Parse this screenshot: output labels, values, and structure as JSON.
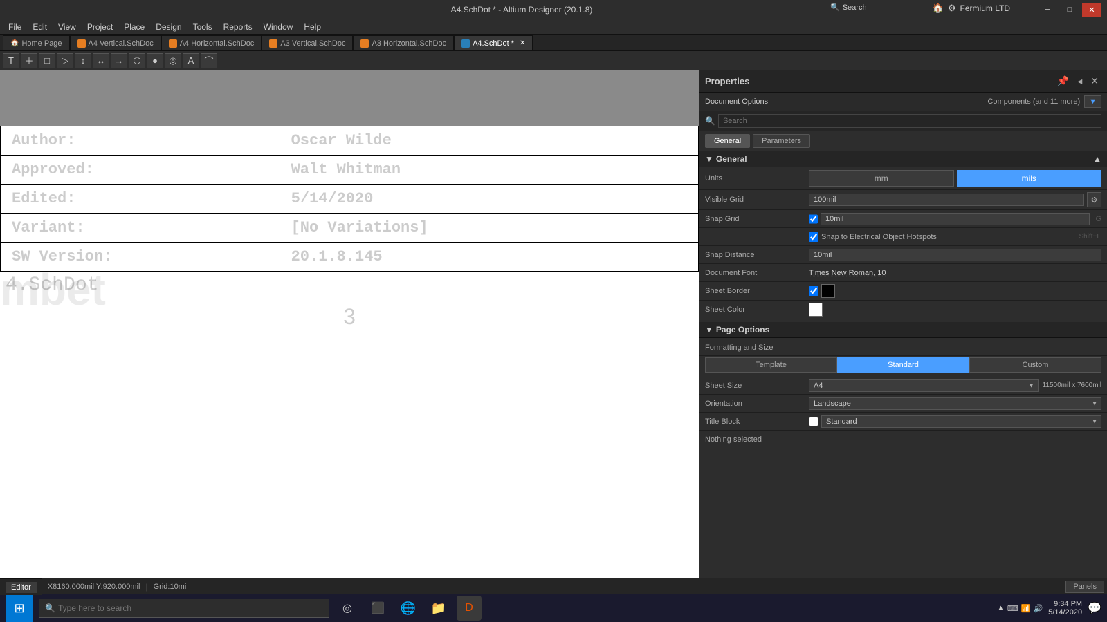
{
  "titlebar": {
    "title": "A4.SchDot * - Altium Designer (20.1.8)",
    "search_label": "Search",
    "win_min": "─",
    "win_max": "□",
    "win_close": "✕"
  },
  "topright": {
    "icons": [
      "🏠",
      "⚙"
    ],
    "company": "Fermium LTD"
  },
  "menubar": {
    "items": [
      "File",
      "Edit",
      "View",
      "Project",
      "Place",
      "Design",
      "Tools",
      "Reports",
      "Window",
      "Help"
    ]
  },
  "tabs": [
    {
      "label": "Home Page",
      "icon": "home",
      "active": false
    },
    {
      "label": "A4 Vertical.SchDoc",
      "active": false
    },
    {
      "label": "A4 Horizontal.SchDoc",
      "active": false
    },
    {
      "label": "A3 Vertical.SchDoc",
      "active": false
    },
    {
      "label": "A3 Horizontal.SchDoc",
      "active": false
    },
    {
      "label": "A4.SchDot *",
      "active": true
    }
  ],
  "toolbar": {
    "buttons": [
      "T",
      "＋",
      "□",
      "▷",
      "↕",
      "↔",
      "→",
      "⬡",
      "●",
      "◎",
      "A",
      "⌒"
    ]
  },
  "canvas": {
    "author_label": "Author:",
    "author_value": "Oscar Wilde",
    "approved_label": "Approved:",
    "approved_value": "Walt Whitman",
    "edited_label": "Edited:",
    "edited_value": "5/14/2020",
    "variant_label": "Variant:",
    "variant_value": "[No Variations]",
    "sw_label": "SW Version:",
    "sw_value": "20.1.8.145",
    "filename": "4.SchDot",
    "page_num": "3",
    "watermark": "mbet"
  },
  "properties": {
    "title": "Properties",
    "components_label": "Components (and 11 more)",
    "search_placeholder": "Search",
    "tabs": [
      "General",
      "Parameters"
    ],
    "general_section": "General",
    "units_label": "Units",
    "unit_mm": "mm",
    "unit_mils": "mils",
    "visible_grid_label": "Visible Grid",
    "visible_grid_value": "100mil",
    "snap_grid_label": "Snap Grid",
    "snap_grid_value": "10mil",
    "snap_key": "G",
    "snap_electrical_label": "Snap to Electrical Object Hotspots",
    "snap_electrical_key": "Shift+E",
    "snap_distance_label": "Snap Distance",
    "snap_distance_value": "10mil",
    "doc_font_label": "Document Font",
    "doc_font_value": "Times New Roman, 10",
    "sheet_border_label": "Sheet Border",
    "sheet_color_label": "Sheet Color",
    "page_options_section": "Page Options",
    "formatting_size_label": "Formatting and Size",
    "format_template": "Template",
    "format_standard": "Standard",
    "format_custom": "Custom",
    "sheet_size_label": "Sheet Size",
    "sheet_size_value": "A4",
    "sheet_size_dims": "11500mil x 7600mil",
    "orientation_label": "Orientation",
    "orientation_value": "Landscape",
    "title_block_label": "Title Block",
    "title_block_value": "Standard",
    "nothing_selected": "Nothing selected"
  },
  "editor_tab": {
    "label": "Editor"
  },
  "statusbar": {
    "coords": "X8160.000mil Y:920.000mil",
    "grid": "Grid:10mil",
    "panels": "Panels"
  },
  "taskbar": {
    "search_placeholder": "Type here to search",
    "time": "9:34 PM",
    "date": "5/14/2020",
    "taskbar_icons": [
      "⊞",
      "🔍",
      "◎",
      "⬛",
      "🌐",
      "📁",
      "D"
    ]
  }
}
